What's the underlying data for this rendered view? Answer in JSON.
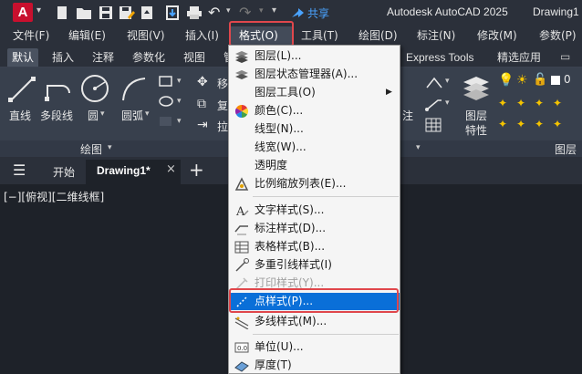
{
  "titlebar": {
    "app_logo": "A",
    "share_label": "共享",
    "app_title": "Autodesk AutoCAD 2025",
    "doc_title": "Drawing1"
  },
  "menubar": {
    "items": [
      "文件(F)",
      "编辑(E)",
      "视图(V)",
      "插入(I)",
      "格式(O)",
      "工具(T)",
      "绘图(D)",
      "标注(N)",
      "修改(M)",
      "参数(P)"
    ]
  },
  "ribbon_tabs": {
    "items": [
      "默认",
      "插入",
      "注释",
      "参数化",
      "视图",
      "管",
      "Express Tools",
      "精选应用"
    ]
  },
  "ribbon": {
    "line": "直线",
    "polyline": "多段线",
    "circle": "圆",
    "arc": "圆弧",
    "move_partial": "移",
    "copy_partial": "复",
    "stretch_partial": "拉",
    "annotate_partial": "注",
    "layer_props": "图层",
    "layer_props2": "特性",
    "draw_panel": "绘图",
    "layer_panel": "图层"
  },
  "doctabs": {
    "start": "开始",
    "drawing": "Drawing1*",
    "add": "+"
  },
  "viewport": {
    "label": "[−][俯视][二维线框]"
  },
  "format_menu": {
    "items": [
      {
        "label": "图层(L)...",
        "icon": "layers-icon"
      },
      {
        "label": "图层状态管理器(A)...",
        "icon": "layer-state-icon"
      },
      {
        "label": "图层工具(O)",
        "icon": "",
        "submenu": true
      },
      {
        "label": "颜色(C)...",
        "icon": "color-wheel-icon"
      },
      {
        "label": "线型(N)...",
        "icon": ""
      },
      {
        "label": "线宽(W)...",
        "icon": ""
      },
      {
        "label": "透明度",
        "icon": ""
      },
      {
        "label": "比例缩放列表(E)...",
        "icon": "scale-list-icon"
      },
      {
        "label": "文字样式(S)...",
        "icon": "text-style-icon"
      },
      {
        "label": "标注样式(D)...",
        "icon": "dim-style-icon"
      },
      {
        "label": "表格样式(B)...",
        "icon": "table-style-icon"
      },
      {
        "label": "多重引线样式(I)",
        "icon": "mleader-style-icon"
      },
      {
        "label": "打印样式(Y)...",
        "icon": "plot-style-icon",
        "disabled": true
      },
      {
        "label": "点样式(P)...",
        "icon": "point-style-icon",
        "selected": true
      },
      {
        "label": "多线样式(M)...",
        "icon": "mline-style-icon"
      },
      {
        "label": "单位(U)...",
        "icon": "units-icon"
      },
      {
        "label": "厚度(T)",
        "icon": "thickness-icon"
      }
    ]
  },
  "colors": {
    "highlight": "#0a6fd8",
    "callout": "#e0474c",
    "app_logo_bg": "#c8102e"
  }
}
